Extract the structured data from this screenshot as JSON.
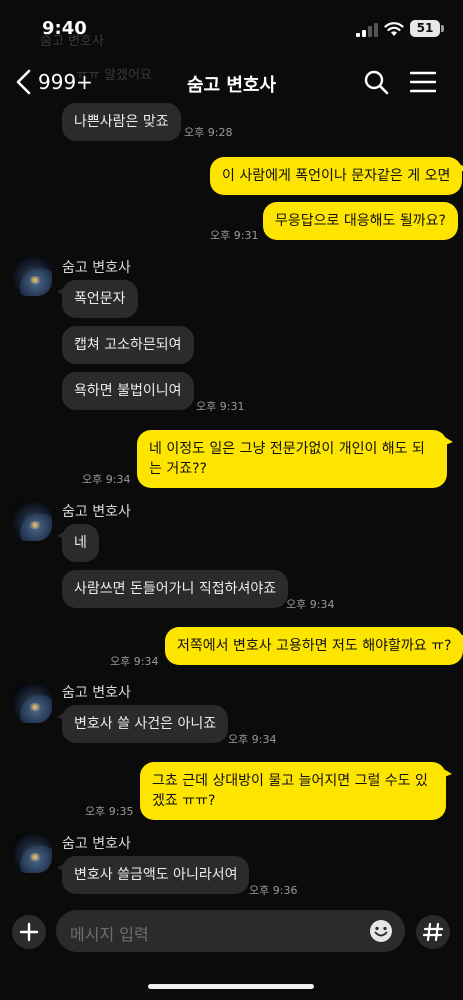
{
  "status_bar": {
    "time": "9:40",
    "battery": "51"
  },
  "background_remnants": {
    "line1": "숨고 변호사",
    "line2": "ㅠㅠ 알겠어요"
  },
  "header": {
    "back_count": "999+",
    "title": "숨고 변호사"
  },
  "messages": [
    {
      "type": "in",
      "text": "나쁜사람은 맞죠",
      "time": "오후 9:28"
    },
    {
      "type": "out",
      "text": "이 사람에게 폭언이나 문자같은 게 오면"
    },
    {
      "type": "out",
      "text": "무응답으로 대응해도 될까요?",
      "time": "오후 9:31"
    },
    {
      "type": "in",
      "sender": "숨고 변호사",
      "text": "폭언문자"
    },
    {
      "type": "in",
      "text": "캡쳐 고소하믄되여"
    },
    {
      "type": "in",
      "text": "욕하면 불법이니여",
      "time": "오후 9:31"
    },
    {
      "type": "out",
      "text": "네 이정도 일은 그냥 전문가없이 개인이 해도 되는 거죠??",
      "time": "오후 9:34"
    },
    {
      "type": "in",
      "sender": "숨고 변호사",
      "text": "네"
    },
    {
      "type": "in",
      "text": "사람쓰면 돈들어가니 직접하셔야죠",
      "time": "오후 9:34"
    },
    {
      "type": "out",
      "text": "저쪽에서 변호사 고용하면 저도 해야할까요 ㅠ?",
      "time": "오후 9:34"
    },
    {
      "type": "in",
      "sender": "숨고 변호사",
      "text": "변호사 쓸 사건은 아니죠",
      "time": "오후 9:34"
    },
    {
      "type": "out",
      "text": "그쵸 근데 상대방이 물고 늘어지면 그럴 수도 있겠죠 ㅠㅠ?",
      "time": "오후 9:35"
    },
    {
      "type": "in",
      "sender": "숨고 변호사",
      "text": "변호사 쓸금액도 아니라서여",
      "time": "오후 9:36"
    }
  ],
  "input": {
    "placeholder": "메시지 입력"
  },
  "icons": [
    "signal-icon",
    "wifi-icon",
    "battery-icon",
    "chevron-left-icon",
    "search-icon",
    "menu-icon",
    "plus-icon",
    "emoji-icon",
    "hash-icon"
  ],
  "colors": {
    "background": "#0b0b0b",
    "incoming_bubble": "#2b2b2b",
    "outgoing_bubble": "#fee500",
    "time_text": "#9a9a9a"
  }
}
